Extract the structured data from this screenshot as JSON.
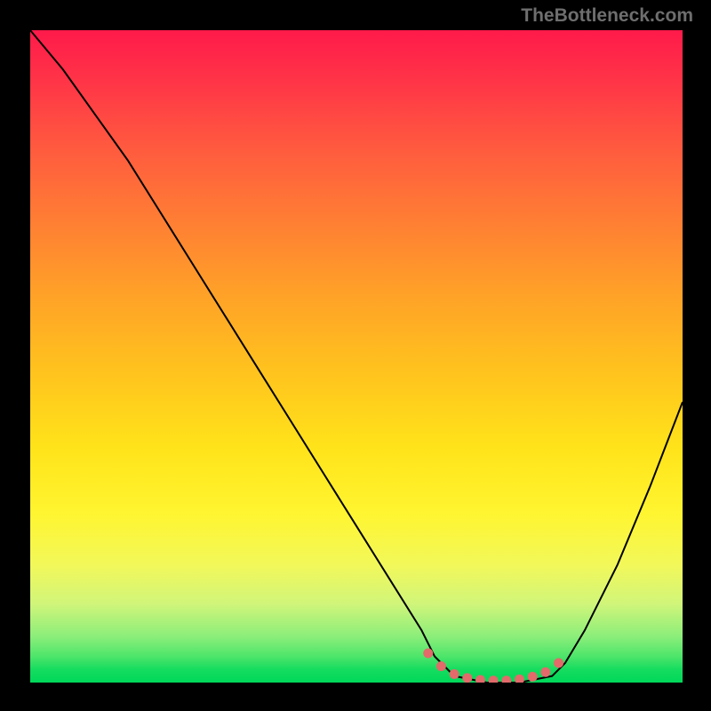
{
  "watermark": "TheBottleneck.com",
  "chart_data": {
    "type": "line",
    "title": "",
    "xlabel": "",
    "ylabel": "",
    "xlim": [
      0,
      100
    ],
    "ylim": [
      0,
      100
    ],
    "series": [
      {
        "name": "curve",
        "x": [
          0,
          5,
          10,
          15,
          20,
          25,
          30,
          35,
          40,
          45,
          50,
          55,
          60,
          62,
          65,
          70,
          75,
          80,
          82,
          85,
          90,
          95,
          100
        ],
        "y": [
          100,
          94,
          87,
          80,
          72,
          64,
          56,
          48,
          40,
          32,
          24,
          16,
          8,
          4,
          1,
          0,
          0,
          1,
          3,
          8,
          18,
          30,
          43
        ]
      },
      {
        "name": "highlight",
        "x": [
          61,
          63,
          65,
          67,
          69,
          71,
          73,
          75,
          77,
          79,
          81
        ],
        "y": [
          4.5,
          2.5,
          1.3,
          0.7,
          0.4,
          0.3,
          0.3,
          0.5,
          0.9,
          1.6,
          3.0
        ]
      }
    ],
    "colors": {
      "curve": "#000000",
      "highlight": "#e26a6a",
      "gradient_top": "#ff1a4a",
      "gradient_bottom": "#00d85a"
    }
  }
}
